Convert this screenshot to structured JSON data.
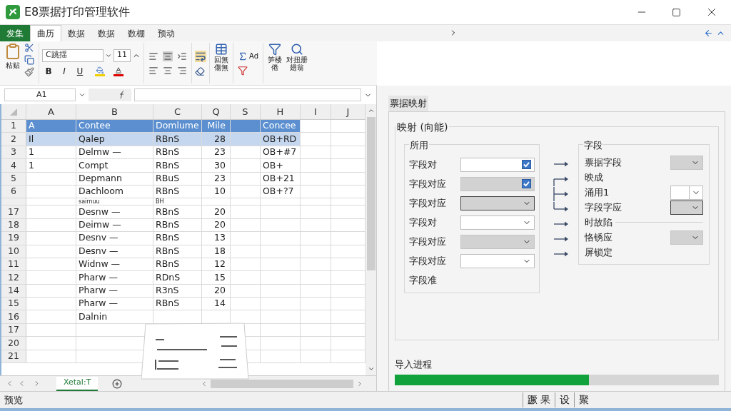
{
  "window": {
    "title": "E8票据打印管理软件"
  },
  "ribbon_tabs": [
    {
      "label": "发集",
      "kind": "file",
      "selected": false
    },
    {
      "label": "曲历",
      "kind": "tab",
      "selected": true
    },
    {
      "label": "数据",
      "kind": "tab",
      "selected": false
    },
    {
      "label": "数据",
      "kind": "tab",
      "selected": false
    },
    {
      "label": "数棚",
      "kind": "tab",
      "selected": false
    },
    {
      "label": "预动",
      "kind": "tab",
      "selected": false
    }
  ],
  "ribbon": {
    "paste_label": "粘贴",
    "font": "C跳揺",
    "size": "11",
    "bold": "B",
    "italic": "I",
    "underline": "U",
    "table_label": [
      "回無",
      "傷無"
    ],
    "sum_label": "Ad",
    "tool_labels": [
      [
        "笋楼",
        "倦"
      ],
      [
        "对扭册",
        "翅翁"
      ]
    ]
  },
  "formula_bar": {
    "cell": "A1"
  },
  "sheet": {
    "columns": [
      "A",
      "B",
      "C",
      "Q",
      "S",
      "H",
      "I",
      "J"
    ],
    "rows": [
      {
        "label": "1",
        "kind": "table-header",
        "selected": false,
        "cells": {
          "a": "A",
          "b": "Contee",
          "c": "Domlume",
          "q": "Mile",
          "h": "Concee"
        }
      },
      {
        "label": "2",
        "kind": "row",
        "selected": true,
        "cells": {
          "a": "Il",
          "b": "Qalep",
          "c": "RBnS",
          "q": "28",
          "h": "OB+RD"
        }
      },
      {
        "label": "3",
        "kind": "row",
        "selected": false,
        "cells": {
          "a": "1",
          "b": "Delmw —",
          "c": "RBnS",
          "q": "23",
          "h": "OB+#7"
        }
      },
      {
        "label": "4",
        "kind": "row",
        "selected": false,
        "cells": {
          "a": "1",
          "b": "Compt",
          "c": "RBnS",
          "q": "30",
          "h": "OB+"
        }
      },
      {
        "label": "5",
        "kind": "row",
        "selected": false,
        "cells": {
          "b": "Depmann",
          "c": "RBuS",
          "q": "23",
          "h": "OB+21"
        }
      },
      {
        "label": "6",
        "kind": "row",
        "selected": false,
        "cells": {
          "b": "Dachloom",
          "c": "RBnS",
          "q": "10",
          "h": "OB+?7"
        }
      },
      {
        "kind": "partial",
        "selected": false,
        "cells": {
          "b": "sairnuu",
          "c": "BH"
        }
      },
      {
        "label": "17",
        "kind": "row",
        "selected": false,
        "cells": {
          "b": "Desnw —",
          "c": "RBnS",
          "q": "20"
        }
      },
      {
        "label": "18",
        "kind": "row",
        "selected": false,
        "cells": {
          "b": "Deimw —",
          "c": "RBnS",
          "q": "20"
        }
      },
      {
        "label": "19",
        "kind": "row",
        "selected": false,
        "cells": {
          "b": "Desnv —",
          "c": "RBnS",
          "q": "13"
        }
      },
      {
        "label": "10",
        "kind": "row",
        "selected": false,
        "cells": {
          "b": "Desnv —",
          "c": "RBnS",
          "q": "18"
        }
      },
      {
        "label": "11",
        "kind": "row",
        "selected": false,
        "cells": {
          "b": "Widnw —",
          "c": "RBnS",
          "q": "12"
        }
      },
      {
        "label": "12",
        "kind": "row",
        "selected": false,
        "cells": {
          "b": "Pharw —",
          "c": "RDnS",
          "q": "15"
        }
      },
      {
        "label": "14",
        "kind": "row",
        "selected": false,
        "cells": {
          "b": "Pharw —",
          "c": "R3nS",
          "q": "20"
        }
      },
      {
        "label": "15",
        "kind": "row",
        "selected": false,
        "cells": {
          "b": "Pharw —",
          "c": "RBnS",
          "q": "14"
        }
      },
      {
        "label": "16",
        "kind": "row",
        "selected": false,
        "cells": {
          "b": "Dalnin"
        }
      },
      {
        "label": "17",
        "kind": "row",
        "selected": false
      },
      {
        "label": "20",
        "kind": "row",
        "selected": false
      },
      {
        "label": "21",
        "kind": "row",
        "selected": false
      }
    ],
    "sheet_tabs": [
      {
        "label": "Xetal:T",
        "selected": true
      }
    ]
  },
  "panel": {
    "tab": "票据映射",
    "fieldset": "映射 (向能)",
    "left_group": {
      "title": "所用",
      "rows": [
        {
          "label": "字段对",
          "kind": "check",
          "checked": true,
          "disabled": false,
          "focused": false
        },
        {
          "label": "字段对应",
          "kind": "check",
          "checked": true,
          "disabled": true,
          "focused": false
        },
        {
          "label": "字段对应",
          "kind": "dropdown",
          "disabled": true,
          "focused": true
        },
        {
          "label": "字段对",
          "kind": "dropdown",
          "disabled": false,
          "focused": false
        },
        {
          "label": "字段对应",
          "kind": "dropdown",
          "disabled": true,
          "focused": false
        },
        {
          "label": "字段对应",
          "kind": "dropdown",
          "disabled": false,
          "focused": false
        },
        {
          "label": "字段准",
          "kind": "label"
        }
      ]
    },
    "arrows": [
      {
        "kind": "straight"
      },
      {
        "kind": "branch-top"
      },
      {
        "kind": "branch-mid"
      },
      {
        "kind": "branch-end"
      },
      {
        "kind": "straight"
      },
      {
        "kind": "straight"
      },
      {
        "kind": "straight"
      }
    ],
    "right_group": {
      "title": "字段",
      "rows": [
        {
          "label": "票据字段",
          "kind": "dropdown",
          "disabled": true,
          "focused": false
        },
        {
          "label": "映成",
          "kind": "label"
        },
        {
          "label": "涌用1",
          "kind": "split",
          "disabled": false,
          "focused": false
        },
        {
          "label": "字段字应",
          "kind": "dropdown",
          "disabled": true,
          "focused": true
        },
        {
          "label": "时故陷",
          "kind": "section"
        },
        {
          "label": "恪锈应",
          "kind": "dropdown",
          "disabled": true,
          "focused": false
        },
        {
          "label": "屏锁定",
          "kind": "label"
        }
      ]
    },
    "progress": {
      "label": "导入进程",
      "level": 0.6
    }
  },
  "status_bar": {
    "left": "预览",
    "items": [
      "蹶 果",
      "设",
      "聚"
    ]
  }
}
